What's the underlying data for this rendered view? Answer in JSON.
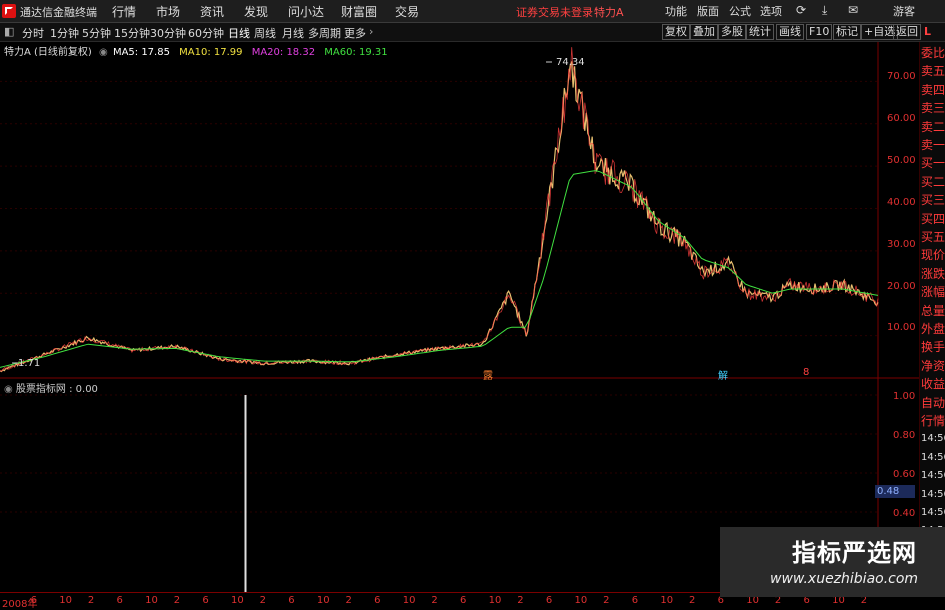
{
  "app": {
    "name": "通达信金融终端"
  },
  "menu": [
    "行情",
    "市场",
    "资讯",
    "发现",
    "问小达",
    "财富圈",
    "交易"
  ],
  "notice": "证券交易未登录",
  "stock_name_top": "特力A",
  "right_menu": [
    "功能",
    "版面",
    "公式",
    "选项"
  ],
  "user": "游客",
  "periods": [
    "分时",
    "1分钟",
    "5分钟",
    "15分钟",
    "30分钟",
    "60分钟",
    "日线",
    "周线",
    "月线",
    "多周期",
    "更多"
  ],
  "active_period": "日线",
  "right_tools": [
    "复权",
    "叠加",
    "多股",
    "统计",
    "画线",
    "F10",
    "标记",
    "+自选",
    "返回"
  ],
  "chart_header": {
    "title": "特力A (日线前复权)",
    "ma5": "MA5: 17.85",
    "ma10": "MA10: 17.99",
    "ma20": "MA20: 18.32",
    "ma60": "MA60: 19.31"
  },
  "colors": {
    "ma5": "#ffffff",
    "ma10": "#f0e040",
    "ma20": "#e040e0",
    "ma60": "#40e040",
    "up": "#ff3030",
    "down": "#30d0ff"
  },
  "price_axis": [
    "70.00",
    "60.00",
    "50.00",
    "40.00",
    "30.00",
    "20.00",
    "10.00"
  ],
  "annotations": {
    "high": "74.34",
    "low": "1.71"
  },
  "right_column": [
    "委比",
    "卖五",
    "卖四",
    "卖三",
    "卖二",
    "卖一",
    "买一",
    "买二",
    "买三",
    "买四",
    "买五",
    "现价",
    "涨跌",
    "涨幅",
    "总量",
    "外盘",
    "换手",
    "净资",
    "收益",
    "自动",
    "行情",
    "14:56",
    "14:56",
    "14:56",
    "14:56",
    "14:56",
    "14:56",
    "14:56",
    "14:56"
  ],
  "indicator": {
    "title": "股票指标网 : 0.00",
    "axis": [
      "1.00",
      "0.80",
      "0.60",
      "0.40"
    ],
    "current": "0.48"
  },
  "x_axis": [
    "2008年",
    "6",
    "10",
    "2",
    "6",
    "10",
    "2",
    "6",
    "10",
    "2",
    "6",
    "10",
    "2",
    "6",
    "10",
    "2",
    "6",
    "10",
    "2",
    "6",
    "10",
    "2",
    "6",
    "10",
    "2",
    "6",
    "10",
    "2",
    "6",
    "10",
    "2"
  ],
  "event_markers": [
    "露",
    "解",
    "8"
  ],
  "watermark": {
    "title": "指标严选网",
    "url": "www.xuezhibiao.com"
  },
  "chart_data": {
    "type": "line",
    "title": "特力A (日线前复权)",
    "ylim": [
      0,
      76
    ],
    "x": [
      0,
      5,
      10,
      15,
      20,
      25,
      30,
      35,
      40,
      45,
      50,
      55,
      58,
      60,
      62,
      65,
      68,
      70,
      72,
      75,
      78,
      80,
      83,
      85,
      88,
      90,
      93,
      96,
      100
    ],
    "series": [
      {
        "name": "price",
        "values": [
          1.71,
          5.5,
          9.5,
          6.5,
          7.5,
          4.5,
          3.5,
          4.0,
          3.5,
          5.5,
          7.0,
          8.0,
          20.0,
          10.0,
          35.0,
          74.34,
          50.0,
          48.0,
          45.0,
          36.0,
          32.0,
          25.0,
          27.0,
          20.0,
          19.0,
          22.0,
          21.0,
          22.0,
          18.0
        ]
      },
      {
        "name": "MA60",
        "values": [
          2.5,
          5.0,
          8.0,
          6.8,
          7.0,
          5.0,
          4.0,
          4.0,
          3.8,
          5.0,
          6.5,
          7.5,
          12.0,
          12.0,
          24.0,
          48.0,
          49.0,
          47.0,
          45.0,
          37.0,
          33.0,
          28.0,
          26.0,
          22.0,
          20.0,
          21.0,
          21.0,
          21.0,
          19.5
        ]
      }
    ],
    "indicator_spikes": [
      {
        "x": 25,
        "y": 1.0
      }
    ]
  }
}
